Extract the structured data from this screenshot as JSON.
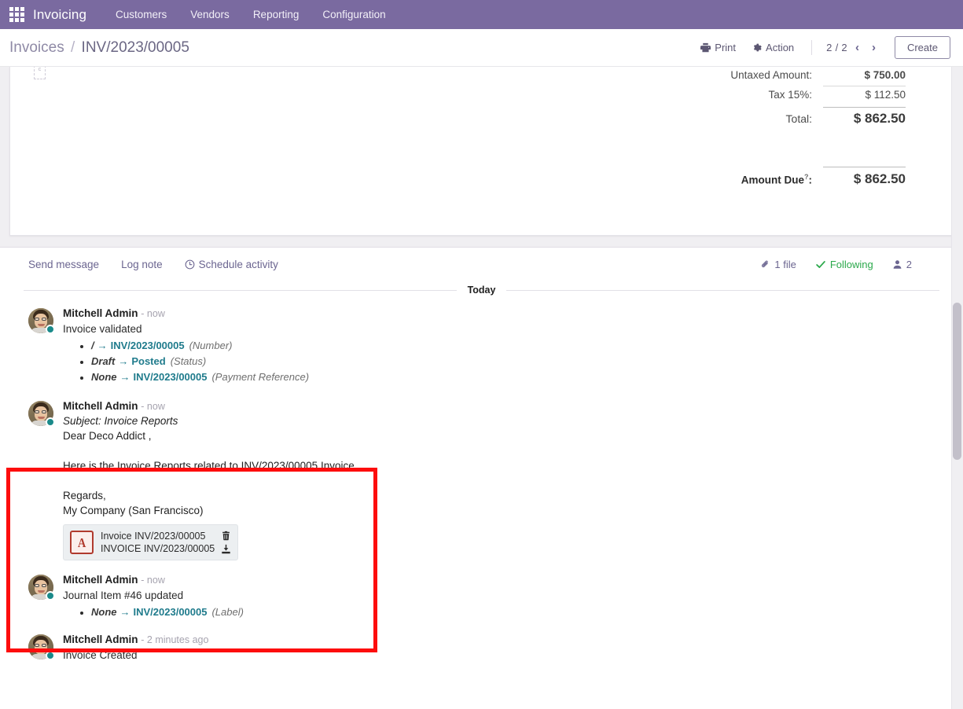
{
  "navbar": {
    "apps_icon": "apps-grid-icon",
    "brand": "Invoicing",
    "items": [
      {
        "label": "Customers"
      },
      {
        "label": "Vendors"
      },
      {
        "label": "Reporting"
      },
      {
        "label": "Configuration"
      }
    ]
  },
  "control_panel": {
    "breadcrumb_root": "Invoices",
    "breadcrumb_sep": "/",
    "breadcrumb_current": "INV/2023/00005",
    "print_label": "Print",
    "print_icon": "printer-icon",
    "action_label": "Action",
    "action_icon": "gear-icon",
    "pager_count": "2 / 2",
    "prev_icon": "chevron-left-icon",
    "next_icon": "chevron-right-icon",
    "create_label": "Create"
  },
  "sheet": {
    "totals": [
      {
        "label": "Untaxed Amount:",
        "value": "$ 750.00",
        "style": "untaxed"
      },
      {
        "label": "Tax 15%:",
        "value": "$ 112.50",
        "style": "tax"
      },
      {
        "label": "Total:",
        "value": "$ 862.50",
        "style": "total"
      },
      {
        "label": "Amount Due",
        "value": "$ 862.50",
        "style": "due",
        "help": "?",
        "suffix": ":"
      }
    ]
  },
  "chatter": {
    "send_message": "Send message",
    "log_note": "Log note",
    "schedule_activity": "Schedule activity",
    "schedule_icon": "clock-icon",
    "attachment_icon": "paperclip-icon",
    "file_count": "1 file",
    "following_icon": "check-icon",
    "following_label": "Following",
    "followers_icon": "user-icon",
    "followers_count": "2",
    "date_separator": "Today",
    "messages": [
      {
        "author": "Mitchell Admin",
        "time": "- now",
        "text": "Invoice validated",
        "highlighted": false,
        "tracking": [
          {
            "old": "/",
            "arrow": "→",
            "new": "INV/2023/00005",
            "field": "(Number)"
          },
          {
            "old": "Draft",
            "arrow": "→",
            "new": "Posted",
            "field": "(Status)"
          },
          {
            "old": "None",
            "arrow": "→",
            "new": "INV/2023/00005",
            "field": "(Payment Reference)"
          }
        ]
      },
      {
        "author": "Mitchell Admin",
        "time": "- now",
        "subject": "Subject: Invoice Reports",
        "highlighted": true,
        "paragraphs": [
          "Dear  Deco Addict ,",
          "",
          "Here is the Invoice Reports related to  INV/2023/00005 Invoice.",
          "",
          "Regards,",
          "My Company (San Francisco)"
        ],
        "attachment": {
          "icon": "pdf-file-icon",
          "glyph": "A",
          "name": "Invoice INV/2023/00005",
          "subname": "INVOICE INV/2023/00005",
          "delete_icon": "trash-icon",
          "download_icon": "download-icon"
        }
      },
      {
        "author": "Mitchell Admin",
        "time": "- now",
        "text": "Journal Item #46 updated",
        "highlighted": false,
        "tracking": [
          {
            "old": "None",
            "arrow": "→",
            "new": "INV/2023/00005",
            "field": "(Label)"
          }
        ]
      },
      {
        "author": "Mitchell Admin",
        "time": "- 2 minutes ago",
        "text": "Invoice Created",
        "highlighted": false,
        "tracking": []
      }
    ]
  },
  "colors": {
    "navbar": "#7a6aa0",
    "accent_link": "#1f7b8c",
    "following_green": "#2ba94b",
    "highlight_red": "#fd0d0d",
    "pdf_red": "#b03a2e"
  }
}
